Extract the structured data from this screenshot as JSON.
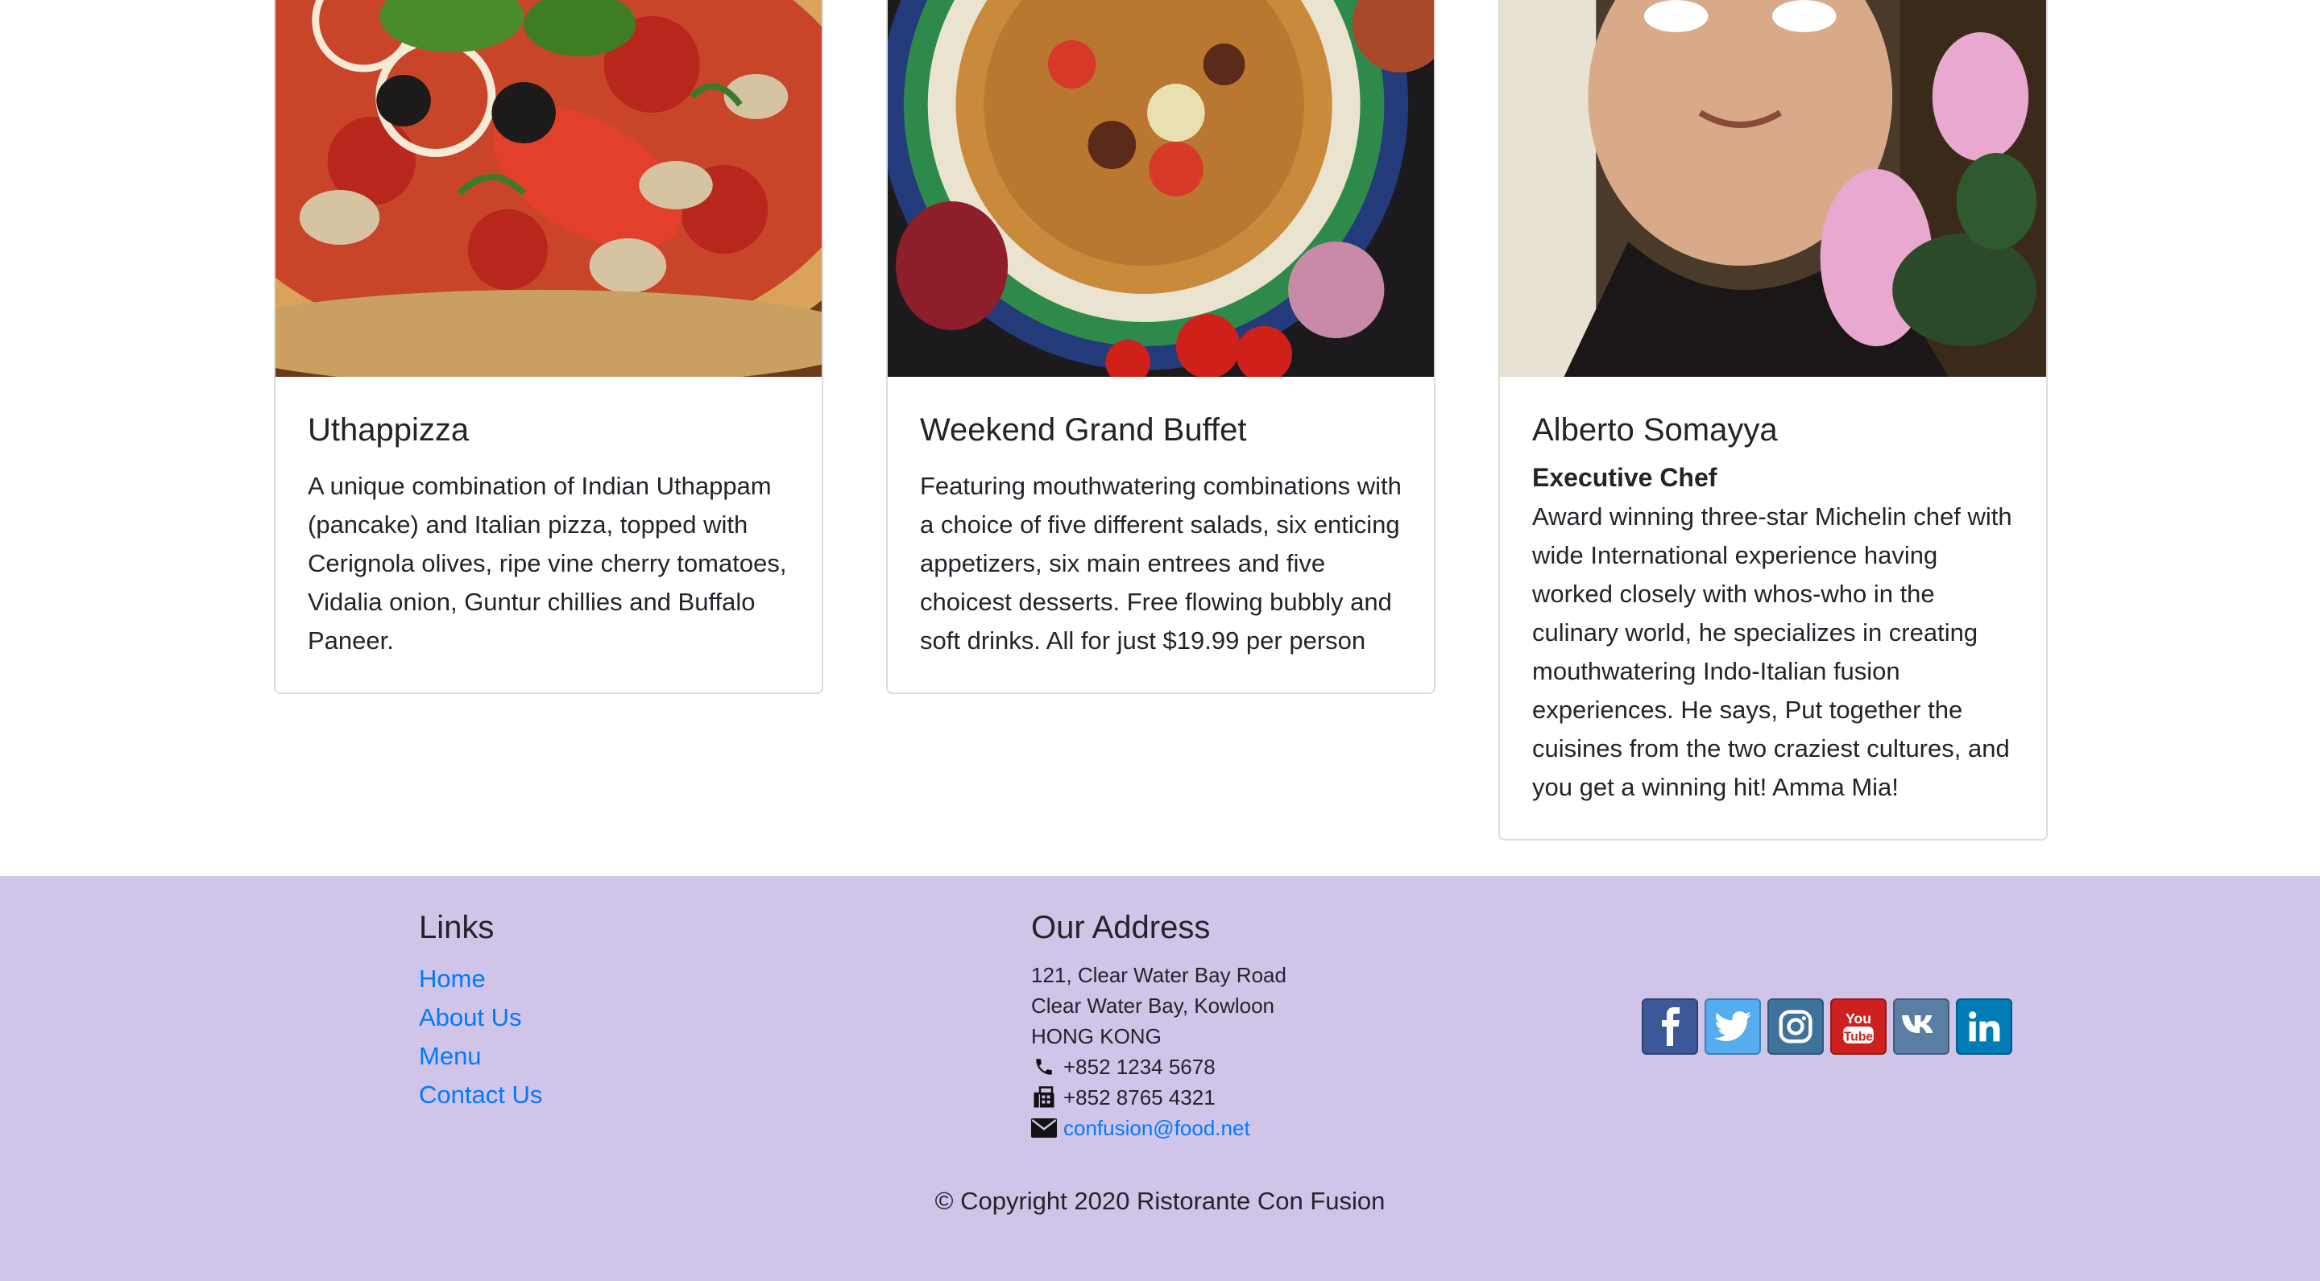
{
  "cards": [
    {
      "image_alt": "pizza",
      "title": "Uthappizza",
      "subtitle": "",
      "text": "A unique combination of Indian Uthappam (pancake) and Italian pizza, topped with Cerignola olives, ripe vine cherry tomatoes, Vidalia onion, Guntur chillies and Buffalo Paneer."
    },
    {
      "image_alt": "buffet",
      "title": "Weekend Grand Buffet",
      "subtitle": "",
      "text": "Featuring mouthwatering combinations with a choice of five different salads, six enticing appetizers, six main entrees and five choicest desserts. Free flowing bubbly and soft drinks. All for just $19.99 per person"
    },
    {
      "image_alt": "chef",
      "title": "Alberto Somayya",
      "subtitle": "Executive Chef",
      "text": "Award winning three-star Michelin chef with wide International experience having worked closely with whos-who in the culinary world, he specializes in creating mouthwatering Indo-Italian fusion experiences. He says, Put together the cuisines from the two craziest cultures, and you get a winning hit! Amma Mia!"
    }
  ],
  "footer": {
    "links_title": "Links",
    "links": [
      "Home",
      "About Us",
      "Menu",
      "Contact Us"
    ],
    "address_title": "Our Address",
    "address_lines": [
      "121, Clear Water Bay Road",
      "Clear Water Bay, Kowloon",
      "HONG KONG"
    ],
    "phone": "+852 1234 5678",
    "fax": "+852 8765 4321",
    "email": "confusion@food.net",
    "socials": [
      {
        "name": "facebook-icon",
        "color": "#3b5998"
      },
      {
        "name": "twitter-icon",
        "color": "#55acee"
      },
      {
        "name": "instagram-icon",
        "color": "#3f729b"
      },
      {
        "name": "youtube-icon",
        "color": "#cd201f"
      },
      {
        "name": "vk-icon",
        "color": "#597da3"
      },
      {
        "name": "linkedin-icon",
        "color": "#007bb6"
      }
    ],
    "copyright": "© Copyright 2020 Ristorante Con Fusion",
    "background": "#d1c4e9",
    "link_color": "#007bff"
  }
}
